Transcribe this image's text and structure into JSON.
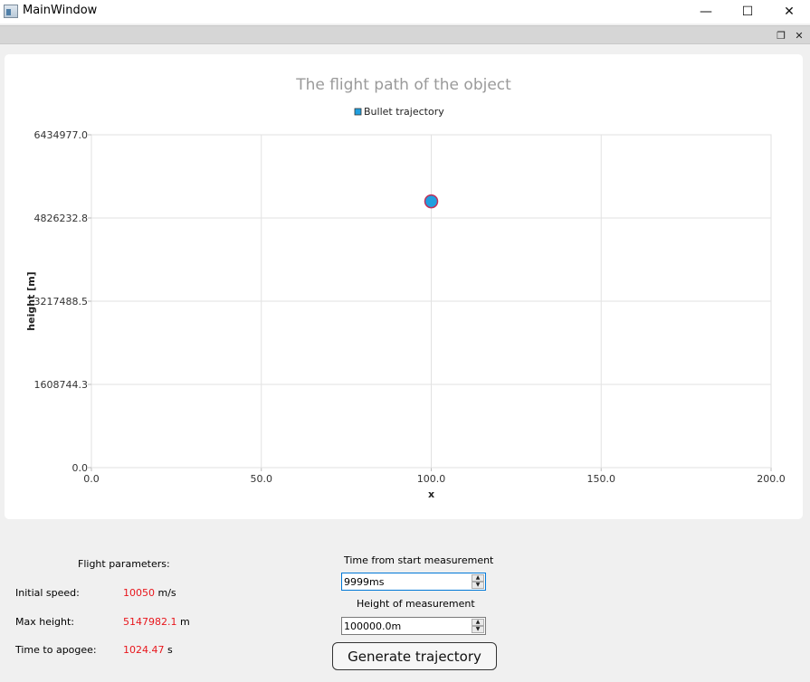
{
  "window": {
    "title": "MainWindow",
    "minimize_glyph": "—",
    "maximize_glyph": "☐",
    "close_glyph": "✕",
    "dock_float_glyph": "❐",
    "dock_close_glyph": "✕"
  },
  "chart_data": {
    "type": "scatter",
    "title": "The flight path of the object",
    "legend": {
      "placement": "top-center",
      "entries": [
        "Bullet trajectory"
      ]
    },
    "xlabel": "x",
    "ylabel": "height [m]",
    "xlim": [
      0.0,
      200.0
    ],
    "ylim": [
      0.0,
      6434977.0
    ],
    "x_ticks": [
      "0.0",
      "50.0",
      "100.0",
      "150.0",
      "200.0"
    ],
    "y_ticks": [
      "0.0",
      "1608744.3",
      "3217488.5",
      "4826232.8",
      "6434977.0"
    ],
    "grid": true,
    "series": [
      {
        "name": "Bullet trajectory",
        "color": "#209fdf",
        "edge_color": "#c0305a",
        "x": [
          100.0
        ],
        "y": [
          5147982.1
        ]
      }
    ]
  },
  "params": {
    "title": "Flight parameters:",
    "initial_speed": {
      "label": "Initial speed:",
      "value": "10050",
      "unit": "m/s"
    },
    "max_height": {
      "label": "Max height:",
      "value": "5147982.1",
      "unit": "m"
    },
    "time_to_apogee": {
      "label": "Time to apogee:",
      "value": "1024.47",
      "unit": "s"
    }
  },
  "controls": {
    "time_label": "Time from start measurement",
    "time_value": "9999ms",
    "height_label": "Height of measurement",
    "height_value": "100000.0m",
    "up_glyph": "▲",
    "down_glyph": "▼",
    "generate_label": "Generate trajectory"
  }
}
